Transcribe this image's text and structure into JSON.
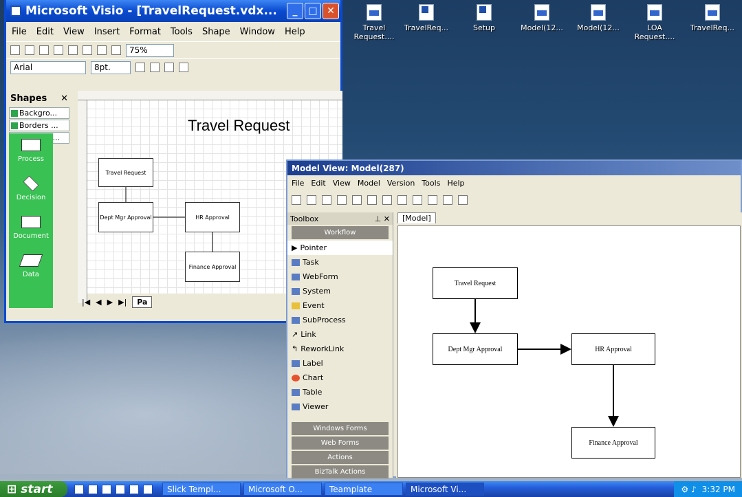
{
  "desktop_icons": [
    {
      "label": "Travel Request....",
      "kind": "v"
    },
    {
      "label": "TravelReq...",
      "kind": "w"
    },
    {
      "label": "Setup",
      "kind": "w"
    },
    {
      "label": "Model(12...",
      "kind": "v"
    },
    {
      "label": "Model(12...",
      "kind": "v"
    },
    {
      "label": "LOA Request....",
      "kind": "v"
    },
    {
      "label": "TravelReq...",
      "kind": "v"
    }
  ],
  "visio": {
    "title": "Microsoft Visio - [TravelRequest.vdx...",
    "menu": [
      "File",
      "Edit",
      "View",
      "Insert",
      "Format",
      "Tools",
      "Shape",
      "Window",
      "Help"
    ],
    "zoom": "75%",
    "font": "Arial",
    "font_size": "8pt.",
    "shapes_title": "Shapes",
    "stencils": [
      "Backgro...",
      "Borders ...",
      "Basic Flo..."
    ],
    "shape_list": [
      "Process",
      "Decision",
      "Document",
      "Data"
    ],
    "page_heading": "Travel Request",
    "boxes": [
      "Travel Request",
      "Dept Mgr Approval",
      "HR Approval",
      "Finance Approval"
    ],
    "page_tab": "Pa"
  },
  "model": {
    "title": "Model View: Model(287)",
    "menu": [
      "File",
      "Edit",
      "View",
      "Model",
      "Version",
      "Tools",
      "Help"
    ],
    "toolbox_label": "Toolbox",
    "tab": "[Model]",
    "sections": {
      "workflow": "Workflow",
      "windows_forms": "Windows Forms",
      "web_forms": "Web Forms",
      "actions": "Actions",
      "biztalk": "BizTalk Actions"
    },
    "tools": [
      "Pointer",
      "Task",
      "WebForm",
      "System",
      "Event",
      "SubProcess",
      "Link",
      "ReworkLink",
      "Label",
      "Chart",
      "Table",
      "Viewer"
    ],
    "boxes": [
      "Travel Request",
      "Dept Mgr Approval",
      "HR Approval",
      "Finance Approval"
    ]
  },
  "taskbar": {
    "start": "start",
    "buttons": [
      "Slick Templ...",
      "Microsoft O...",
      "Teamplate",
      "Microsoft Vi..."
    ],
    "clock": "3:32 PM"
  }
}
